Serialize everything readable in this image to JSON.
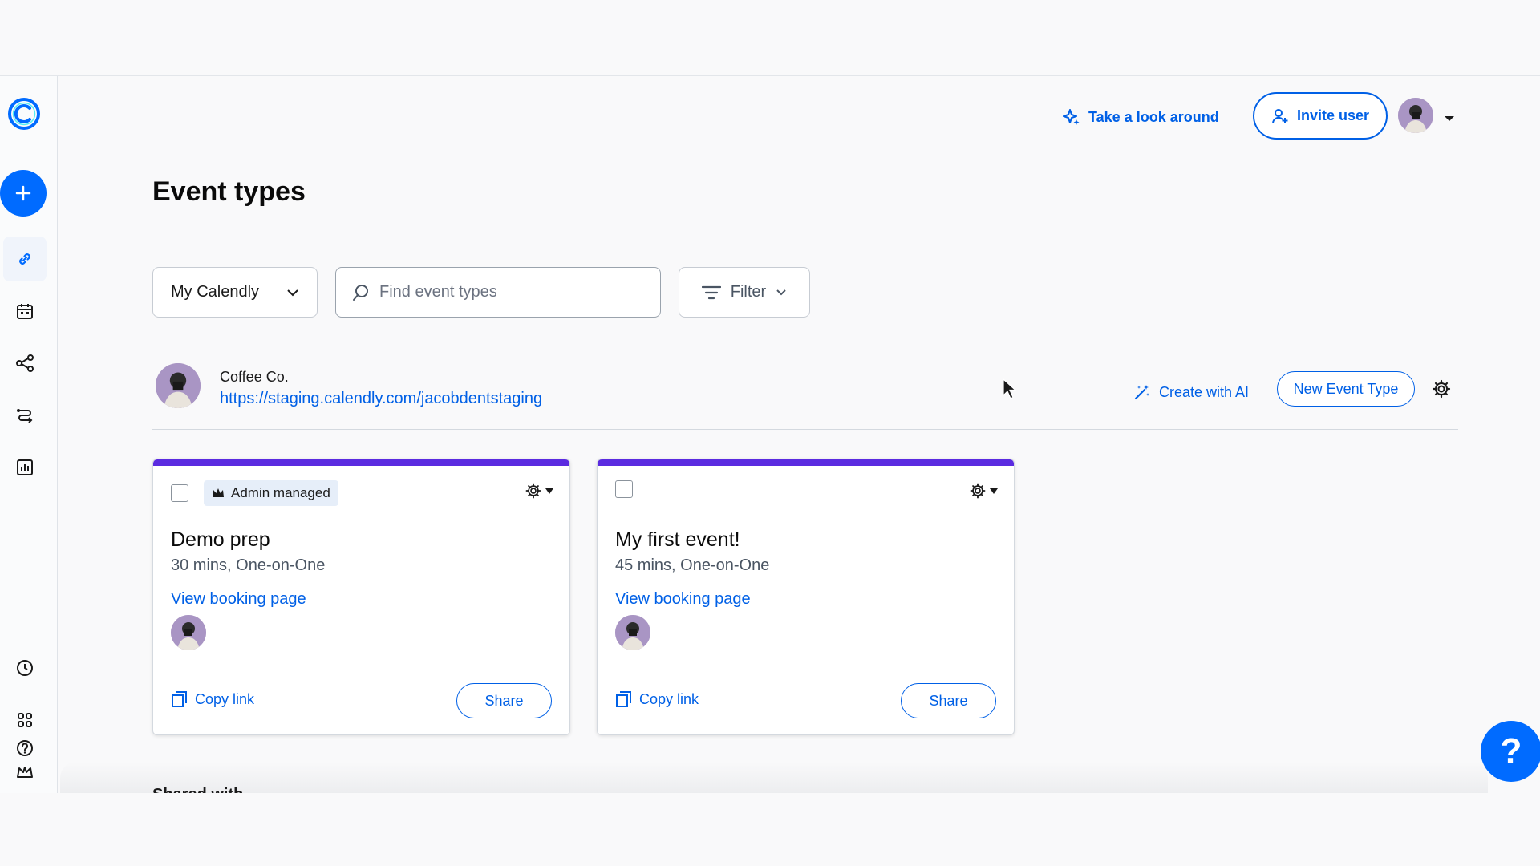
{
  "header": {
    "take_look_label": "Take a look around",
    "invite_label": "Invite user"
  },
  "page": {
    "title": "Event types"
  },
  "controls": {
    "calendar_select_value": "My Calendly",
    "search_placeholder": "Find event types",
    "filter_label": "Filter"
  },
  "owner": {
    "name": "Coffee Co.",
    "link": "https://staging.calendly.com/jacobdentstaging",
    "create_ai_label": "Create with AI",
    "new_event_label": "New Event Type"
  },
  "cards": [
    {
      "badge": "Admin managed",
      "title": "Demo prep",
      "meta": "30 mins, One-on-One",
      "view_label": "View booking page",
      "copy_label": "Copy link",
      "share_label": "Share",
      "strip_color": "#5b2be0"
    },
    {
      "title": "My first event!",
      "meta": "45 mins, One-on-One",
      "view_label": "View booking page",
      "copy_label": "Copy link",
      "share_label": "Share",
      "strip_color": "#5b2be0"
    }
  ],
  "shared_section": {
    "heading": "Shared with"
  },
  "help": {
    "label": "?"
  },
  "colors": {
    "accent": "#006bff",
    "link": "#0060e6",
    "card_strip": "#5b2be0"
  },
  "icons": {
    "sidebar": [
      "link-icon",
      "calendar-icon",
      "workflow-icon",
      "routing-icon",
      "analytics-icon",
      "availability-clock-icon",
      "apps-grid-icon",
      "admin-crown-icon",
      "help-circle-icon"
    ]
  }
}
